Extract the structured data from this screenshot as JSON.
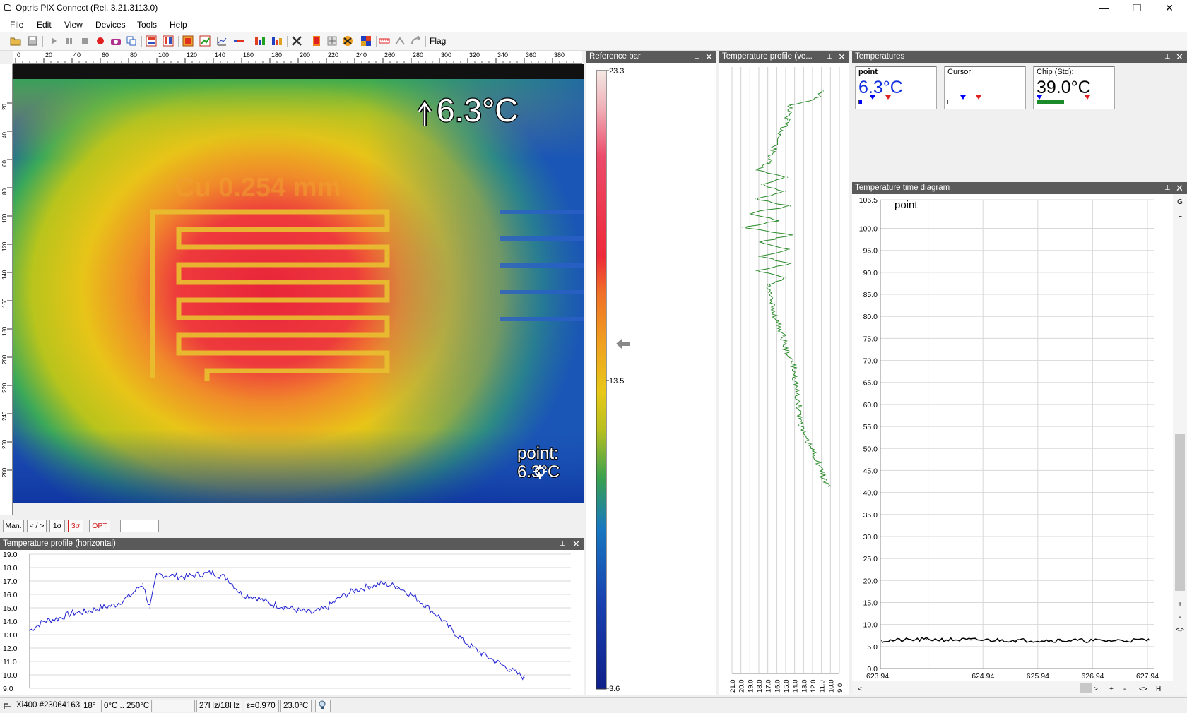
{
  "window": {
    "title": "Optris PIX Connect (Rel. 3.21.3113.0)",
    "controls": {
      "minimize": "—",
      "maximize": "❐",
      "close": "✕"
    }
  },
  "menu": [
    "File",
    "Edit",
    "View",
    "Devices",
    "Tools",
    "Help"
  ],
  "toolbar": {
    "icons": [
      "open-icon",
      "save-icon",
      "play-icon",
      "pause-icon",
      "stop-icon",
      "record-icon",
      "snapshot-icon",
      "copy-icon",
      "palette-icon",
      "layout-icon",
      "profile-icon",
      "chart-icon",
      "line-icon",
      "thermometer-icon",
      "flag-group-icon",
      "tools-icon",
      "hot-icon",
      "cold-icon",
      "checker-icon",
      "grid-icon",
      "measure-icon",
      "settings-icon",
      "refresh-icon"
    ],
    "flag_label": "Flag"
  },
  "thermal": {
    "overlay_temp": "6.3°C",
    "marker_label": "point:",
    "marker_value": "6.3°C",
    "ruler_top": [
      "0",
      "20",
      "40",
      "60",
      "80",
      "100",
      "120",
      "140",
      "160",
      "180",
      "200",
      "220",
      "240",
      "260",
      "280",
      "300",
      "320",
      "340",
      "360",
      "380"
    ],
    "ruler_left": [
      "20",
      "40",
      "60",
      "80",
      "100",
      "120",
      "140",
      "160",
      "180",
      "200",
      "220",
      "240",
      "260",
      "280"
    ],
    "embossed_text": "Cu 0.254 mm"
  },
  "image_buttons": {
    "man": "Man.",
    "range": "< / >",
    "sigma1": "1σ",
    "sigma3": "3σ",
    "opt": "OPT"
  },
  "panels": {
    "reference_bar": "Reference bar",
    "vprofile": "Temperature profile (ve...",
    "temperatures": "Temperatures",
    "hprofile": "Temperature profile (horizontal)",
    "time_diagram": "Temperature time diagram",
    "pin": "⊥",
    "close": "✕"
  },
  "reference_bar": {
    "max": "23.3",
    "mid": "13.5",
    "min": "3.6"
  },
  "temperatures": {
    "point": {
      "label": "point",
      "value": "6.3°C",
      "fill": 0.04,
      "color": "#0000ff"
    },
    "cursor": {
      "label": "Cursor:",
      "value": ""
    },
    "chip": {
      "label": "Chip (Std):",
      "value": "39.0°C",
      "fill": 0.37,
      "color": "#1a8a2a"
    }
  },
  "time_diagram": {
    "legend": "point",
    "y_ticks": [
      "106.5",
      "100.0",
      "95.0",
      "90.0",
      "85.0",
      "80.0",
      "75.0",
      "70.0",
      "65.0",
      "60.0",
      "55.0",
      "50.0",
      "45.0",
      "40.0",
      "35.0",
      "30.0",
      "25.0",
      "20.0",
      "15.0",
      "10.0",
      "5.0",
      "0.0"
    ],
    "x_ticks": [
      "623.94",
      "624.94",
      "625.94",
      "626.94",
      "627.94"
    ],
    "side_buttons": [
      "G",
      "L",
      "+",
      "-",
      "<>"
    ],
    "bottom_buttons": [
      "<",
      ">",
      "+",
      "-",
      "<>",
      "H"
    ]
  },
  "status": {
    "device": "Xi400 #23064163",
    "fov": "18°",
    "range": "0°C .. 250°C",
    "blank": "",
    "rate": "27Hz/18Hz",
    "emissivity": "ε=0.970",
    "ambient": "23.0°C"
  },
  "chart_data": [
    {
      "type": "line",
      "title": "Temperature profile (horizontal)",
      "xlabel": "",
      "ylabel": "",
      "ylim": [
        9.0,
        19.0
      ],
      "y_ticks": [
        "19.0",
        "18.0",
        "17.0",
        "16.0",
        "15.0",
        "14.0",
        "13.0",
        "12.0",
        "11.0",
        "10.0",
        "9.0"
      ],
      "grid": true,
      "series": [
        {
          "color": "#2020d0",
          "x": [
            0,
            20,
            40,
            60,
            80,
            100,
            120,
            140,
            160,
            170,
            180,
            200,
            220,
            240,
            260,
            280,
            300,
            320,
            340,
            360,
            380,
            400,
            420,
            440,
            460,
            480,
            500,
            520,
            540,
            560,
            580,
            600,
            620,
            640,
            660,
            680,
            700
          ],
          "values": [
            13.3,
            14.0,
            14.2,
            14.6,
            14.7,
            15.0,
            15.2,
            15.8,
            16.8,
            15.0,
            17.5,
            17.4,
            17.3,
            17.5,
            17.6,
            17.2,
            16.0,
            15.8,
            15.3,
            15.1,
            14.8,
            14.6,
            15.0,
            15.8,
            16.3,
            16.6,
            16.8,
            16.6,
            16.0,
            15.2,
            14.3,
            13.2,
            12.3,
            11.6,
            11.0,
            10.4,
            9.8
          ]
        }
      ]
    },
    {
      "type": "line",
      "title": "Temperature profile (vertical)",
      "xlim": [
        21.0,
        9.0
      ],
      "x_ticks": [
        "21.0",
        "20.0",
        "19.0",
        "18.0",
        "17.0",
        "16.0",
        "15.0",
        "14.0",
        "13.0",
        "12.0",
        "11.0",
        "10.0",
        "9.0"
      ],
      "grid": true,
      "series": [
        {
          "color": "#2a8a2a",
          "y": [
            0,
            5,
            10,
            20,
            30,
            40,
            50,
            55,
            60,
            65,
            70,
            75,
            80,
            85,
            90,
            95,
            100,
            105,
            110,
            115,
            120,
            125,
            130,
            135,
            140,
            150,
            160,
            170,
            180,
            190,
            200,
            210,
            220,
            230,
            240,
            250,
            260,
            270,
            275
          ],
          "values": [
            10.8,
            11.5,
            14.5,
            14.8,
            15.6,
            16.3,
            17.0,
            18.3,
            14.8,
            17.7,
            15.0,
            18.4,
            14.5,
            19.0,
            15.8,
            19.8,
            14.2,
            17.9,
            14.6,
            18.0,
            14.5,
            18.3,
            15.0,
            17.0,
            16.9,
            16.5,
            16.0,
            15.3,
            15.0,
            14.2,
            13.9,
            13.8,
            13.5,
            13.3,
            13.0,
            12.0,
            11.2,
            10.7,
            10.2
          ]
        }
      ]
    },
    {
      "type": "line",
      "title": "Temperature time diagram",
      "ylim": [
        0.0,
        106.5
      ],
      "x": [
        "623.94",
        "624.94",
        "625.94",
        "626.94",
        "627.94"
      ],
      "grid": true,
      "series": [
        {
          "name": "point",
          "color": "#000000",
          "values": [
            6.3,
            6.6,
            6.5,
            6.4,
            6.4,
            6.3,
            6.5
          ]
        }
      ]
    }
  ]
}
